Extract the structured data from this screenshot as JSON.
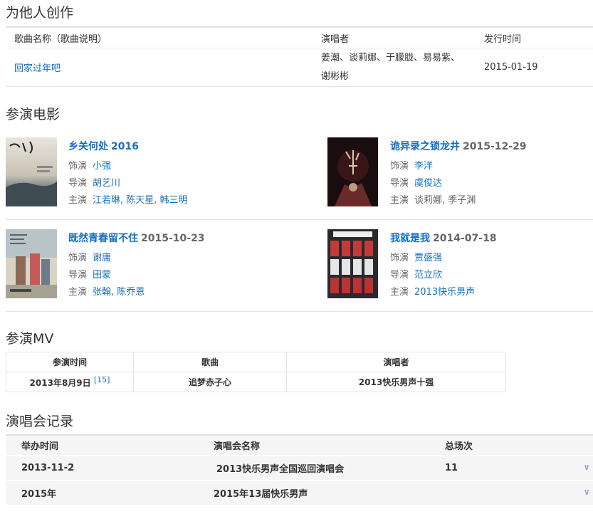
{
  "section_compose": {
    "title": "为他人创作",
    "headers": [
      "歌曲名称（歌曲说明）",
      "演唱者",
      "发行时间"
    ],
    "rows": [
      {
        "song": "回家过年吧",
        "singers_line1": "姜潮、谈莉娜、于朦胧、易易紫、",
        "singers_line2": "谢彬彬",
        "date": "2015-01-19"
      }
    ]
  },
  "section_films": {
    "title": "参演电影",
    "labels": {
      "role": "饰演",
      "director": "导演",
      "cast": "主演"
    },
    "films": [
      {
        "title": "乡关何处",
        "date": "2016",
        "role": "小强",
        "director": "胡艺川",
        "cast": "江若琳, 陈天星, 韩三明"
      },
      {
        "title": "诡异录之锁龙井",
        "date": "2015-12-29",
        "role": "李洋",
        "director": "虞俊达",
        "cast": "谈莉娜, 季子渊"
      },
      {
        "title": "既然青春留不住",
        "date": "2015-10-23",
        "role": "谢庸",
        "director": "田蒙",
        "cast": "张翰, 陈乔恩"
      },
      {
        "title": "我就是我",
        "date": "2014-07-18",
        "role": "贾盛强",
        "director": "范立欣",
        "cast": "2013快乐男声"
      }
    ]
  },
  "section_mv": {
    "title": "参演MV",
    "headers": [
      "参演时间",
      "歌曲",
      "演唱者"
    ],
    "rows": [
      {
        "date": "2013年8月9日",
        "ref": "[15]",
        "song": "追梦赤子心",
        "singer": "2013快乐男声十强"
      }
    ]
  },
  "section_concert": {
    "title": "演唱会记录",
    "headers": [
      "举办时间",
      "演唱会名称",
      "总场次"
    ],
    "rows": [
      {
        "date": "2013-11-2",
        "name": "2013快乐男声全国巡回演唱会",
        "count": "11"
      },
      {
        "date": "2015年",
        "name": "2015年13届快乐男声",
        "count": ""
      }
    ]
  },
  "icons": {
    "expand": "chevron-down-icon"
  },
  "colors": {
    "link": "#136ec2",
    "header_bg": "#f5f5f5",
    "border": "#e3e3e3"
  }
}
